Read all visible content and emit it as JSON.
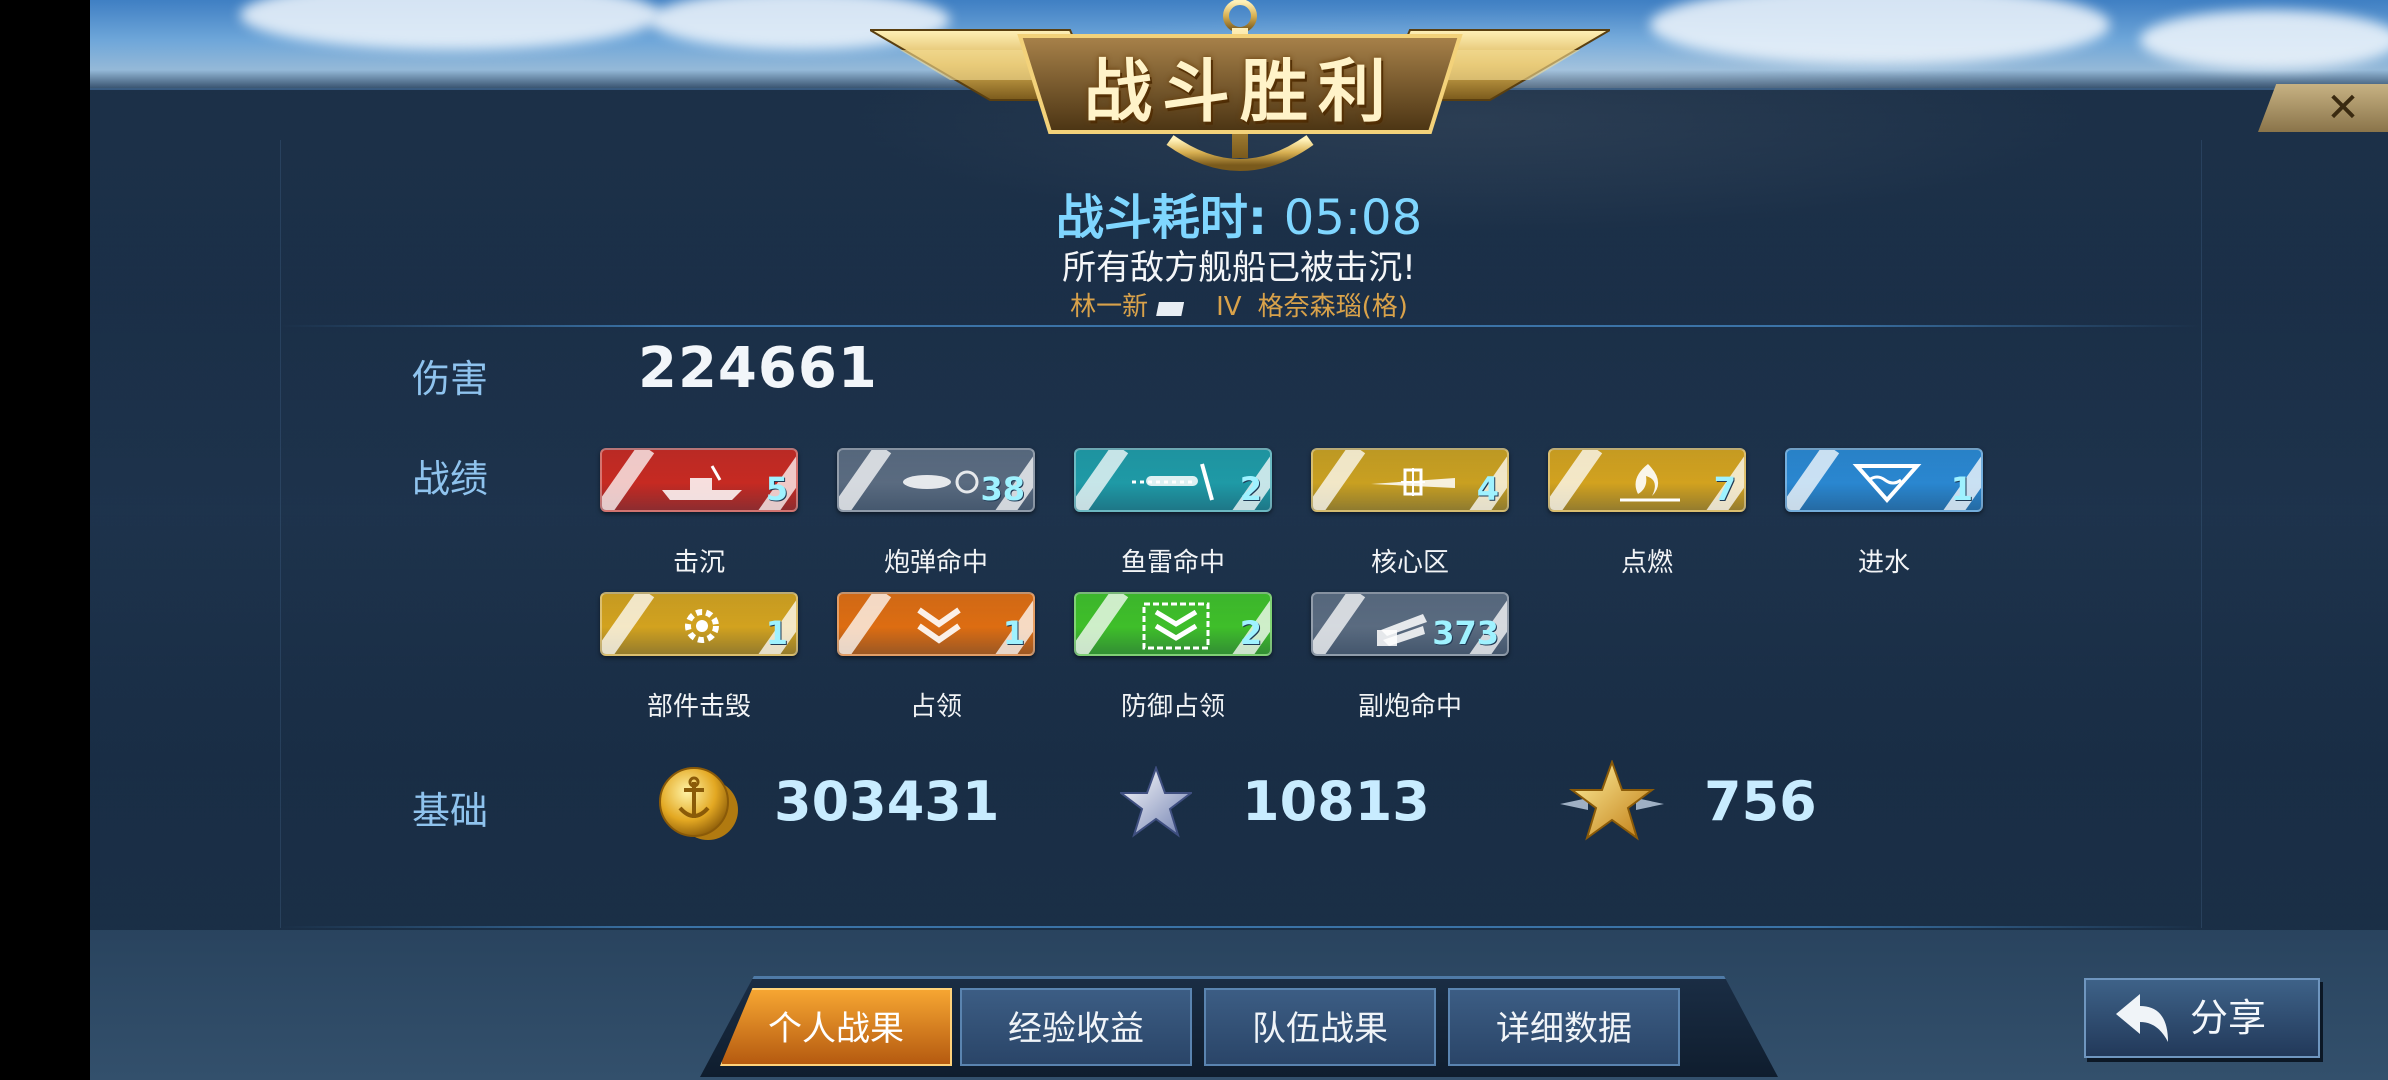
{
  "title": "战斗胜利",
  "close_label": "✕",
  "battle_time": {
    "label": "战斗耗时:",
    "value": "05:08"
  },
  "result_message": "所有敌方舰船已被击沉!",
  "ship": {
    "player": "林一新",
    "tier": "IV",
    "name": "格奈森瑙(格)"
  },
  "damage": {
    "label": "伤害",
    "value": "224661"
  },
  "achievements": {
    "label": "战绩",
    "items": [
      {
        "name": "击沉",
        "count": "5",
        "color": "#c62a22",
        "icon": "ship-sunk-icon"
      },
      {
        "name": "炮弹命中",
        "count": "38",
        "color": "#5a6b80",
        "icon": "shell-hit-icon"
      },
      {
        "name": "鱼雷命中",
        "count": "2",
        "color": "#1f9aa6",
        "icon": "torpedo-hit-icon"
      },
      {
        "name": "核心区",
        "count": "4",
        "color": "#c9a021",
        "icon": "citadel-icon"
      },
      {
        "name": "点燃",
        "count": "7",
        "color": "#d2a21f",
        "icon": "fire-icon"
      },
      {
        "name": "进水",
        "count": "1",
        "color": "#2a87d0",
        "icon": "flooding-icon"
      },
      {
        "name": "部件击毁",
        "count": "1",
        "color": "#d2a21f",
        "icon": "gear-icon"
      },
      {
        "name": "占领",
        "count": "1",
        "color": "#dd6d12",
        "icon": "capture-chevron-icon"
      },
      {
        "name": "防御占领",
        "count": "2",
        "color": "#3fbf2a",
        "icon": "defend-chevron-icon"
      },
      {
        "name": "副炮命中",
        "count": "373",
        "color": "#5a6b80",
        "icon": "secondary-gun-icon"
      }
    ]
  },
  "base": {
    "label": "基础",
    "coins": "303431",
    "exp": "10813",
    "captain_exp": "756"
  },
  "tabs": [
    {
      "label": "个人战果",
      "active": true
    },
    {
      "label": "经验收益",
      "active": false
    },
    {
      "label": "队伍战果",
      "active": false
    },
    {
      "label": "详细数据",
      "active": false
    }
  ],
  "share_label": "分享"
}
